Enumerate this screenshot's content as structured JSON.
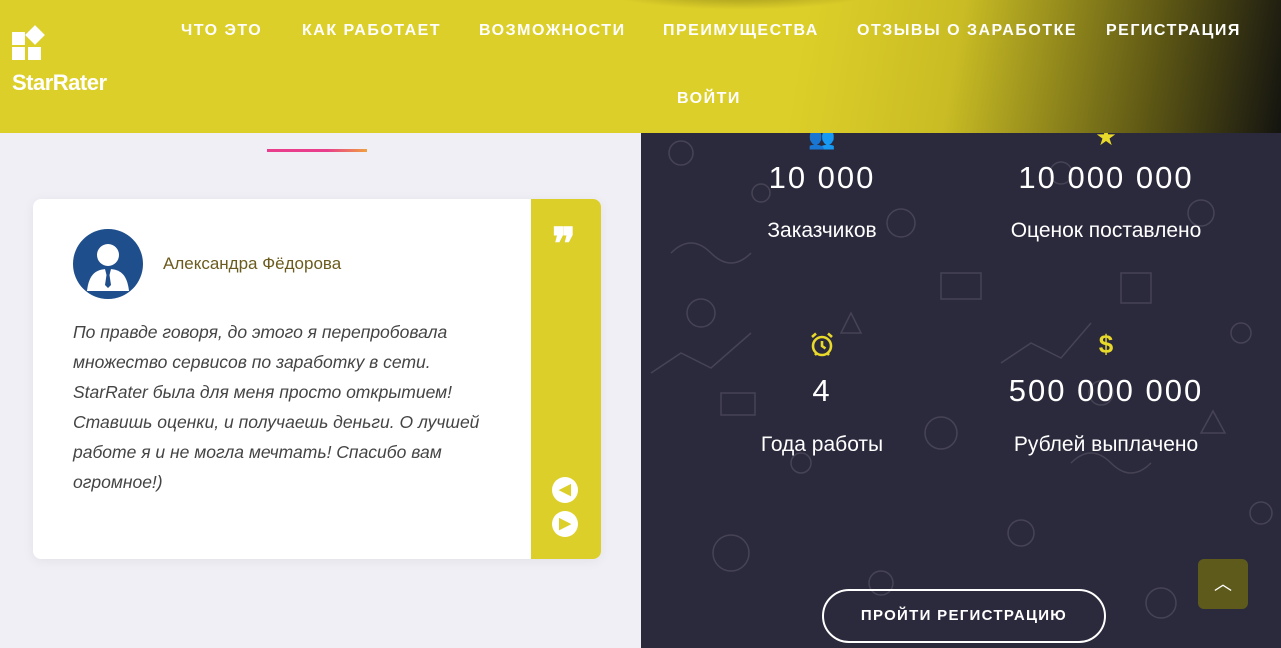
{
  "logo": {
    "text": "StarRater"
  },
  "nav": {
    "items": [
      "ЧТО ЭТО",
      "КАК РАБОТАЕТ",
      "ВОЗМОЖНОСТИ",
      "ПРЕИМУЩЕСТВА",
      "ОТЗЫВЫ О ЗАРАБОТКЕ",
      "РЕГИСТРАЦИЯ",
      "ВОЙТИ"
    ]
  },
  "testimonial": {
    "author": "Александра Фёдорова",
    "text": "По правде говоря, до этого я перепробовала множество сервисов по заработку в сети. StarRater была для меня просто открытием! Ставишь оценки, и получаешь деньги. О лучшей работе я и не могла мечтать! Спасибо вам огромное!)",
    "quote_icon": "quote-icon",
    "prev_icon": "arrow-left-icon",
    "next_icon": "arrow-right-icon"
  },
  "stats": [
    {
      "value": "10 000",
      "label": "Заказчиков",
      "icon": "users-icon"
    },
    {
      "value": "10 000 000",
      "label": "Оценок поставлено",
      "icon": "star-icon"
    },
    {
      "value": "4",
      "label": "Года работы",
      "icon": "alarm-clock-icon"
    },
    {
      "value": "500 000 000",
      "label": "Рублей выплачено",
      "icon": "dollar-icon"
    }
  ],
  "cta": {
    "label": "ПРОЙТИ РЕГИСТРАЦИЮ"
  },
  "scroll_top": {
    "icon": "chevron-up-icon"
  },
  "colors": {
    "accent": "#ddcf29",
    "dark_panel": "#2b293c",
    "author": "#6b5b1e",
    "avatar": "#1e4e8c"
  }
}
